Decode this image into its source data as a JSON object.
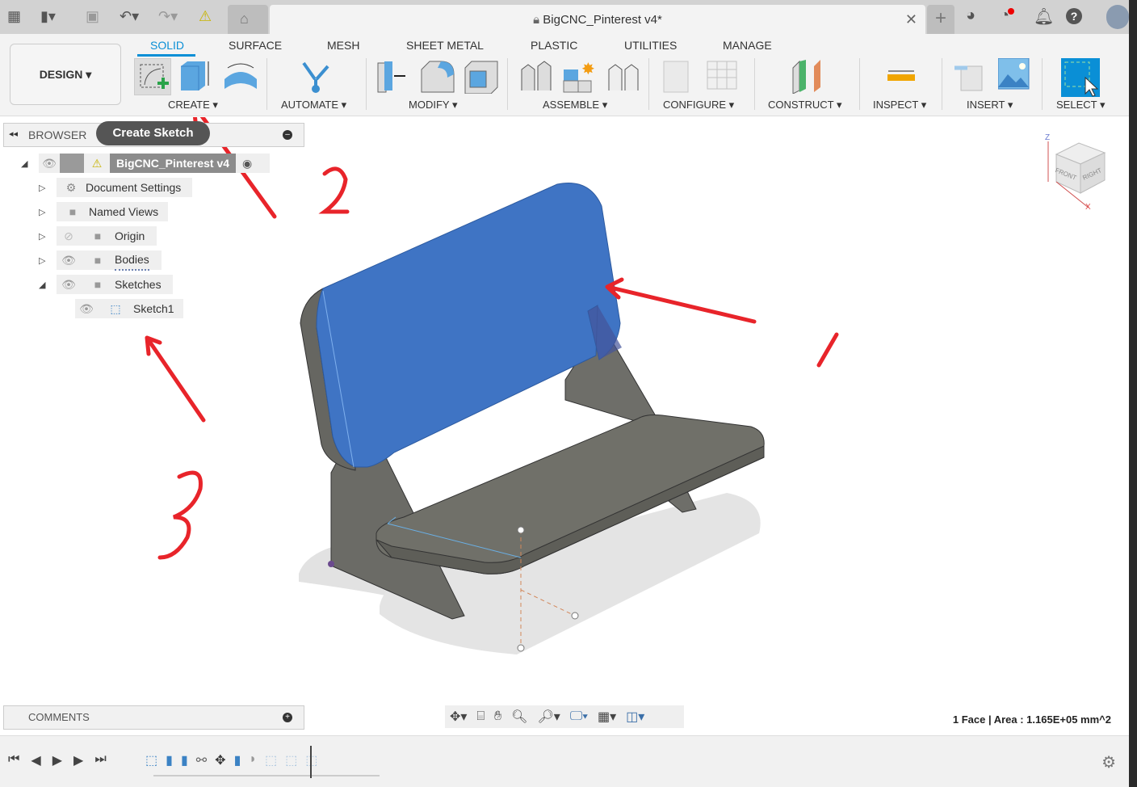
{
  "titlebar": {
    "document_title": "BigCNC_Pinterest v4*",
    "icons": [
      "grid-icon",
      "file-icon",
      "save-icon",
      "undo-icon",
      "redo-icon",
      "warning-icon",
      "home-icon",
      "lock-icon",
      "close-icon",
      "plus-icon",
      "extensions-icon",
      "job-status-icon",
      "bell-icon",
      "help-icon",
      "avatar"
    ]
  },
  "workspace": {
    "label": "DESIGN"
  },
  "ribbon_tabs": [
    {
      "label": "SOLID",
      "active": true
    },
    {
      "label": "SURFACE"
    },
    {
      "label": "MESH"
    },
    {
      "label": "SHEET METAL"
    },
    {
      "label": "PLASTIC"
    },
    {
      "label": "UTILITIES"
    },
    {
      "label": "MANAGE"
    }
  ],
  "groups": [
    "CREATE",
    "AUTOMATE",
    "MODIFY",
    "ASSEMBLE",
    "CONFIGURE",
    "CONSTRUCT",
    "INSPECT",
    "INSERT",
    "SELECT"
  ],
  "tooltip": "Create Sketch",
  "browser": {
    "title": "BROWSER",
    "root": "BigCNC_Pinterest v4",
    "items": [
      "Document Settings",
      "Named Views",
      "Origin",
      "Bodies",
      "Sketches",
      "Sketch1"
    ]
  },
  "comments": "COMMENTS",
  "status": "1 Face | Area : 1.165E+05 mm^2",
  "viewcube": {
    "faces": [
      "FRONT",
      "RIGHT"
    ],
    "axes": [
      "Z",
      "X"
    ]
  },
  "annotations": {
    "numbers": [
      "1",
      "2",
      "3"
    ],
    "color": "#e8242a"
  },
  "colors": {
    "accent": "#0a8fd6",
    "selected_face": "#3f74c4",
    "body": "#6e6e68"
  }
}
